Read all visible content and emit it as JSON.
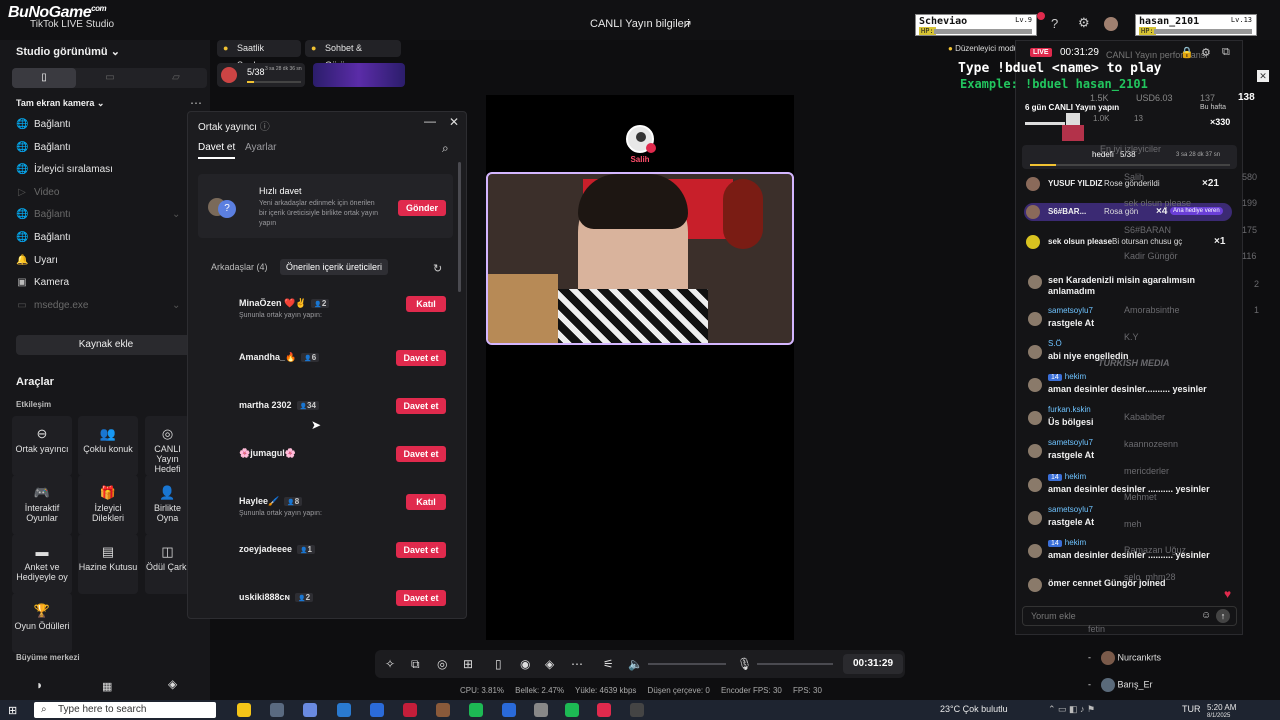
{
  "app": {
    "brand": "BuNoGame",
    "brand_sub": "com",
    "window_title": "TikTok LIVE Studio",
    "live_info": "CANLI Yayın bilgileri"
  },
  "hud": {
    "player1": {
      "name": "Scheviao",
      "level": "Lv.9",
      "hp": "HP:"
    },
    "player2": {
      "name": "hasan_2101",
      "level": "Lv.13",
      "hp": "HP:"
    }
  },
  "overlay": {
    "line1": "Type !bduel <name> to play",
    "line2": "Example: !bduel hasan_2101",
    "line1_color": "#ffffff",
    "line2_color": "#22c55e"
  },
  "sidebar": {
    "scene_title": "Studio görünümü",
    "orientation": [
      "Dikey",
      "Yatay",
      "Diğer"
    ],
    "camera_mode": "Tam ekran kamera",
    "sources": [
      {
        "label": "Bağlantı",
        "icon": "globe-icon",
        "dim": false
      },
      {
        "label": "Bağlantı",
        "icon": "globe-icon",
        "dim": false
      },
      {
        "label": "İzleyici sıralaması",
        "icon": "globe-icon",
        "dim": false
      },
      {
        "label": "Video",
        "icon": "play-icon",
        "dim": true
      },
      {
        "label": "Bağlantı",
        "icon": "globe-icon",
        "dim": true
      },
      {
        "label": "Bağlantı",
        "icon": "globe-icon",
        "dim": false
      },
      {
        "label": "Uyarı",
        "icon": "bell-icon",
        "dim": false
      },
      {
        "label": "Kamera",
        "icon": "camera-icon",
        "dim": false
      },
      {
        "label": "msedge.exe",
        "icon": "window-icon",
        "dim": true
      }
    ],
    "add_source": "Kaynak ekle",
    "tools_title": "Araçlar",
    "interaction_title": "Etkileşim",
    "tools": [
      {
        "label": "Ortak yayıncı",
        "icon": "link-icon"
      },
      {
        "label": "Çoklu konuk",
        "icon": "users-icon"
      },
      {
        "label": "CANLI Yayın Hedefi",
        "icon": "target-icon"
      },
      {
        "label": "İnteraktif Oyunlar",
        "icon": "gamepad-icon"
      },
      {
        "label": "İzleyici Dilekleri",
        "icon": "gift-icon"
      },
      {
        "label": "Birlikte Oyna",
        "icon": "user-icon"
      },
      {
        "label": "Anket ve Hediyeyle oy",
        "icon": "poll-icon"
      },
      {
        "label": "Hazine Kutusu",
        "icon": "chest-icon"
      },
      {
        "label": "Ödül Çarkı",
        "icon": "wheel-icon"
      },
      {
        "label": "Oyun Ödülleri",
        "icon": "trophy-icon"
      }
    ],
    "growth_title": "Büyüme merkezi"
  },
  "strip": {
    "hourly_rank": "Saatlik Sıralama",
    "chat_meet": "Sohbet & Görüşme",
    "goal_progress": "5/38",
    "goal_timer": "3 sa 28 dk 36 sn",
    "editor_mode": "Düzenleyici modu"
  },
  "popup": {
    "title": "Ortak yayıncı",
    "tabs": [
      "Davet et",
      "Ayarlar"
    ],
    "quick_title": "Hızlı davet",
    "quick_desc": "Yeni arkadaşlar edinmek için önerilen bir içerik üreticisiyle birlikte ortak yayın yapın",
    "quick_button": "Gönder",
    "segments": [
      "Arkadaşlar (4)",
      "Önerilen içerik üreticileri"
    ],
    "creators": [
      {
        "name": "MinaÖzen ❤️✌️",
        "count": "2",
        "action": "Katıl",
        "sub": "Şununla ortak yayın yapın:"
      },
      {
        "name": "Amandha_🔥",
        "count": "6",
        "action": "Davet et",
        "sub": ""
      },
      {
        "name": "martha 2302",
        "count": "34",
        "action": "Davet et",
        "sub": ""
      },
      {
        "name": "🌸jumagul🌸",
        "count": "",
        "action": "Davet et",
        "sub": ""
      },
      {
        "name": "Haylee🖌️",
        "count": "8",
        "action": "Katıl",
        "sub": "Şununla ortak yayın yapın:"
      },
      {
        "name": "zoeyjadeeee",
        "count": "1",
        "action": "Davet et",
        "sub": ""
      },
      {
        "name": "uskiki888ᴄɴ",
        "count": "2",
        "action": "Davet et",
        "sub": ""
      }
    ]
  },
  "preview": {
    "host_label": "Salih"
  },
  "controls": {
    "timer": "00:31:29"
  },
  "stats": {
    "cpu": "CPU: 3.81%",
    "memory": "Bellek: 2.47%",
    "upload": "Yükle: 4639 kbps",
    "dropped": "Düşen çerçeve: 0",
    "encoder_fps": "Encoder FPS: 30",
    "fps": "FPS: 30"
  },
  "rightpanel": {
    "live_badge": "LIVE",
    "live_timer": "00:31:29",
    "perf_title": "CANLI Yayın performansı",
    "viewers": "138",
    "views": "1.5K",
    "usd": "USD6.03",
    "likes": "137",
    "extra": "1.0K",
    "counter3": "13",
    "streak": "6 gün CANLI Yayın yapın",
    "week_label": "Bu hafta",
    "week_value": "×330",
    "goal_label": "hedefi",
    "goal_value": "5/38",
    "goal_timer": "3 sa 28 dk 37 sn",
    "top_viewers": "En iyi izleyiciler",
    "gifts": [
      {
        "user": "YUSUF YILDIZ",
        "text": "Rose gönderildi",
        "mult": "×21"
      },
      {
        "user": "S6#BAR...",
        "text": "Rosa gön",
        "mult": "×4",
        "tag": "Ana hediye veren"
      },
      {
        "user": "sek olsun please",
        "text": "Bi otursan chusu gç",
        "mult": "×1"
      }
    ],
    "comments": [
      {
        "user": "",
        "msg": "sen Karadenizli misin agaralımısın anlamadım"
      },
      {
        "user": "sametsoylu7",
        "msg": "rastgele At"
      },
      {
        "user": "S.Ö",
        "msg": "abi niye engelledin"
      },
      {
        "user": "hekim",
        "badge": "14",
        "msg": "aman desinler desinler.......... yesinler"
      },
      {
        "user": "furkan.kskin",
        "msg": "Üs bölgesi"
      },
      {
        "user": "sametsoylu7",
        "msg": "rastgele At"
      },
      {
        "user": "hekim",
        "badge": "14",
        "msg": "aman desinler desinler .......... yesinler"
      },
      {
        "user": "sametsoylu7",
        "msg": "rastgele At"
      },
      {
        "user": "hekim",
        "badge": "14",
        "msg": "aman desinler desinler .......... yesinler"
      },
      {
        "user": "",
        "msg": "ömer cennet Güngör joined"
      }
    ],
    "ghost_names": [
      "Salih",
      "sek olsun please",
      "S6#BARAN",
      "Kadir Güngör",
      "Amorabsinthe",
      "K.Y",
      "Kababiber",
      "kaannozeenn",
      "mericderler",
      "Mehmet",
      "meh",
      "Ramazan Uğuz",
      "selo_mhm28",
      "fetin"
    ],
    "ghost_counts": [
      "580",
      "199",
      "175",
      "116",
      "2",
      "1"
    ],
    "comment_placeholder": "Yorum ekle",
    "viewer_rows": [
      "Nurcankrts",
      "Barış_Er"
    ],
    "watermark": "TURKISH MEDIA"
  },
  "taskbar": {
    "search_placeholder": "Type here to search",
    "weather": "23°C  Çok bulutlu",
    "lang": "TUR",
    "time": "5:20 AM",
    "date": "8/1/2025"
  },
  "colors": {
    "accent_red": "#e02a4d",
    "brand_bg": "#0e0e10",
    "chat_user": "#6ec3ff",
    "purple_frame": "#d4b6ff"
  }
}
